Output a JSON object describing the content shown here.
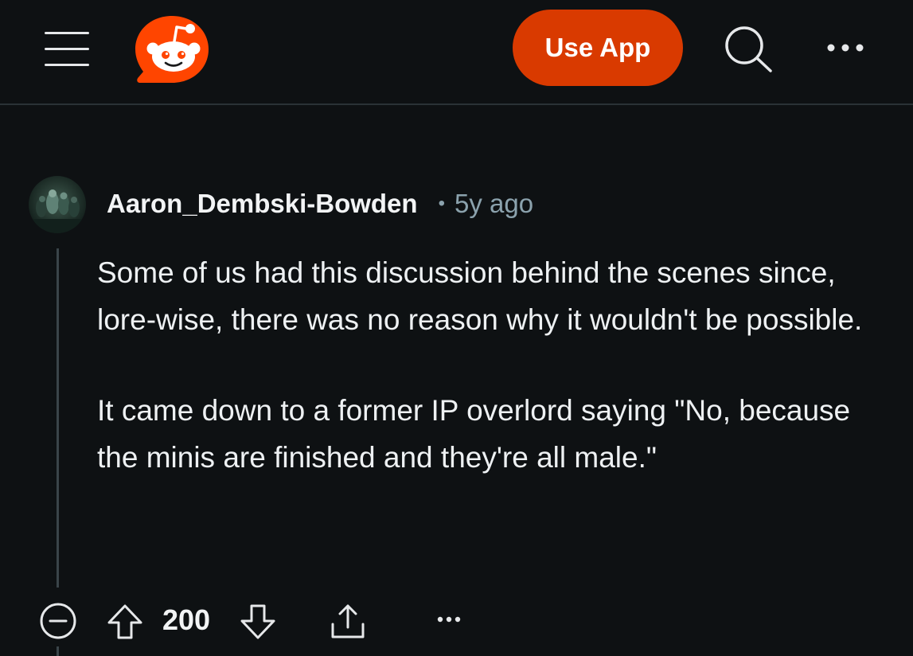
{
  "header": {
    "menu_icon": "hamburger-menu-icon",
    "logo_icon": "reddit-snoo-logo",
    "use_app_label": "Use App",
    "search_icon": "search-icon",
    "more_icon": "ellipsis-horizontal-icon"
  },
  "comment": {
    "author": "Aaron_Dembski-Bowden",
    "separator": "•",
    "time": "5y ago",
    "paragraphs": [
      "Some of us had this discussion behind the scenes since, lore-wise, there was no reason why it wouldn't be possible.",
      "It came down to a former IP overlord saying \"No, because the minis are finished and they're all male.\""
    ],
    "score": "200"
  },
  "actions": {
    "collapse_icon": "collapse-minus-circle-icon",
    "upvote_icon": "upvote-arrow-icon",
    "downvote_icon": "downvote-arrow-icon",
    "share_icon": "share-icon",
    "overflow_icon": "ellipsis-horizontal-icon"
  },
  "colors": {
    "background": "#0e1113",
    "accent": "#d93a00",
    "meta_text": "#8ba2ad",
    "divider": "#2a3236"
  }
}
